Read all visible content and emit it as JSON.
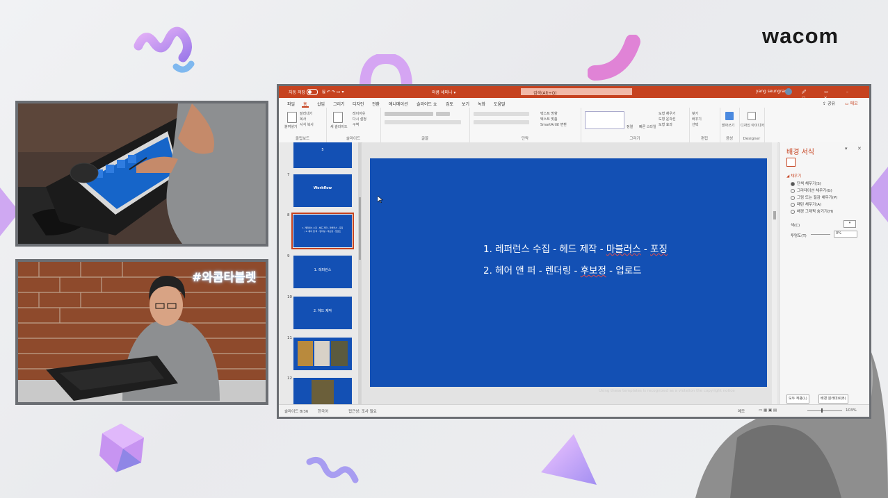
{
  "brand": {
    "logo_text": "wacom"
  },
  "stream": {
    "hashtag": "#와콤타블렛"
  },
  "ppt": {
    "titlebar": {
      "autosave_label": "자동 저장",
      "doc_title": "와콤 세미나 ▾",
      "search_placeholder": "검색(Alt+Q)",
      "user_name": "yang seungram",
      "window_buttons": "🖉 ▭ – ▢ ✕"
    },
    "tabs": [
      "파일",
      "홈",
      "삽입",
      "그리기",
      "디자인",
      "전환",
      "애니메이션",
      "슬라이드 쇼",
      "검토",
      "보기",
      "녹화",
      "도움말"
    ],
    "active_tab": "홈",
    "share_label": "공유",
    "comment_label": "메모",
    "ribbon_groups": [
      {
        "name": "클립보드",
        "items": [
          "붙여넣기",
          "잘라내기",
          "복사",
          "서식 복사"
        ]
      },
      {
        "name": "슬라이드",
        "items": [
          "새 슬라이드",
          "레이아웃",
          "다시 설정",
          "구역"
        ]
      },
      {
        "name": "글꼴",
        "items": []
      },
      {
        "name": "단락",
        "items": [
          "텍스트 방향",
          "텍스트 맞춤",
          "SmartArt로 변환"
        ]
      },
      {
        "name": "그리기",
        "items": [
          "정렬",
          "빠른 스타일",
          "도형 채우기",
          "도형 윤곽선",
          "도형 효과"
        ]
      },
      {
        "name": "편집",
        "items": [
          "찾기",
          "바꾸기",
          "선택"
        ]
      },
      {
        "name": "음성",
        "items": [
          "받아쓰기"
        ]
      },
      {
        "name": "Designer",
        "items": [
          "디자인 아이디어"
        ]
      }
    ],
    "thumbnails": [
      {
        "num": "",
        "text": "5"
      },
      {
        "num": "7",
        "text": "Workflow"
      },
      {
        "num": "8",
        "text": "1. 레퍼런스 수집 - 헤드 제작 - 마블러스 - 포징 / 2. 헤어 앤 퍼 - 렌더링 - 후보정 - 업로드",
        "selected": true
      },
      {
        "num": "9",
        "text": "1. 레퍼런스"
      },
      {
        "num": "10",
        "text": "2. 헤드 제작"
      },
      {
        "num": "11",
        "text": ""
      },
      {
        "num": "12",
        "text": ""
      }
    ],
    "slide": {
      "line1_parts": [
        "1. 레퍼런스 수집 - 헤드 제작 - ",
        "마블러스",
        " - ",
        "포징"
      ],
      "line2_parts": [
        "2. 헤어 앤 퍼 - 렌더링 - ",
        "후보정",
        " - 업로드"
      ],
      "designer_note": "Using these templates is recognized as a violation the copyright notice"
    },
    "format_pane": {
      "title": "배경 서식",
      "section": "채우기",
      "options": [
        {
          "label": "단색 채우기(S)",
          "selected": true
        },
        {
          "label": "그라데이션 채우기(G)",
          "selected": false
        },
        {
          "label": "그림 또는 질감 채우기(P)",
          "selected": false
        },
        {
          "label": "패턴 채우기(A)",
          "selected": false
        },
        {
          "label": "배경 그래픽 숨기기(H)",
          "selected": false
        }
      ],
      "color_label": "색(C)",
      "transparency_label": "투명도(T)",
      "transparency_value": "0%",
      "apply_all_button": "모두 적용(L)",
      "reset_button": "배경 원래대로(B)"
    },
    "statusbar": {
      "slide_info": "슬라이드 8/36",
      "language": "한국어",
      "accessibility": "접근성: 조사 필요",
      "notes": "메모",
      "zoom": "103%"
    },
    "colors": {
      "accent": "#c6421f",
      "slide_bg": "#1350b4"
    }
  }
}
